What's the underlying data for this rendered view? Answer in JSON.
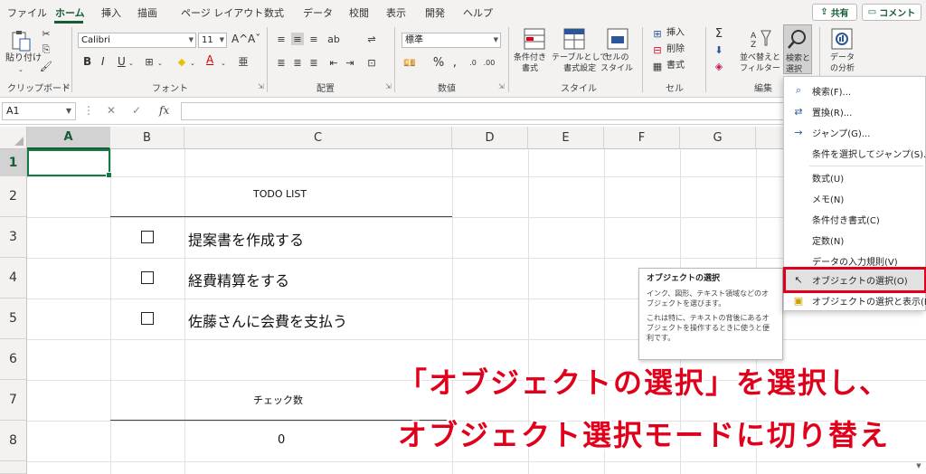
{
  "tabs": [
    "ファイル",
    "ホーム",
    "挿入",
    "描画",
    "ページ レイアウト",
    "数式",
    "データ",
    "校閲",
    "表示",
    "開発",
    "ヘルプ"
  ],
  "share_label": "共有",
  "comment_label": "コメント",
  "ribbon": {
    "clipboard": {
      "paste": "貼り付け",
      "label": "クリップボード"
    },
    "font": {
      "name": "Calibri",
      "size": "11",
      "grow": "A^",
      "shrink": "Aˇ",
      "bold": "B",
      "italic": "I",
      "underline": "U",
      "label": "フォント"
    },
    "alignment": {
      "label": "配置"
    },
    "number": {
      "format": "標準",
      "label": "数値"
    },
    "styles": {
      "cond_format": "条件付き\n書式",
      "table_format": "テーブルとして\n書式設定",
      "cell_style": "セルの\nスタイル",
      "label": "スタイル"
    },
    "cells": {
      "insert": "挿入",
      "delete": "削除",
      "format": "書式",
      "label": "セル"
    },
    "editing": {
      "sort": "並べ替えと\nフィルター",
      "find": "検索と\n選択",
      "label": "編集"
    },
    "analysis": {
      "analyze": "データ\nの分析"
    }
  },
  "formula_bar": {
    "name_box": "A1",
    "fx": "fx"
  },
  "columns": [
    "A",
    "B",
    "C",
    "D",
    "E",
    "F",
    "G"
  ],
  "rows": [
    "1",
    "2",
    "3",
    "4",
    "5",
    "6",
    "7",
    "8"
  ],
  "sheet": {
    "todo_title": "TODO LIST",
    "items": [
      "提案書を作成する",
      "経費精算をする",
      "佐藤さんに会費を支払う"
    ],
    "check_label": "チェック数",
    "check_value": "0"
  },
  "menu": [
    {
      "label": "検索(F)...",
      "icon": "search-icon"
    },
    {
      "label": "置換(R)...",
      "icon": "replace-icon"
    },
    {
      "label": "ジャンプ(G)...",
      "icon": "arrow-right-icon"
    },
    {
      "label": "条件を選択してジャンプ(S)...",
      "icon": ""
    },
    {
      "label": "数式(U)",
      "icon": ""
    },
    {
      "label": "メモ(N)",
      "icon": ""
    },
    {
      "label": "条件付き書式(C)",
      "icon": ""
    },
    {
      "label": "定数(N)",
      "icon": ""
    },
    {
      "label": "データの入力規則(V)",
      "icon": ""
    },
    {
      "label": "オブジェクトの選択(O)",
      "icon": "cursor-icon"
    },
    {
      "label": "オブジェクトの選択と表示(P)...",
      "icon": "selection-pane-icon"
    }
  ],
  "tooltip": {
    "title": "オブジェクトの選択",
    "line1": "インク、図形、テキスト領域などのオブジェクトを選びます。",
    "line2": "これは特に、テキストの背後にあるオブジェクトを操作するときに使うと便利です。"
  },
  "overlay": {
    "line1": "「オブジェクトの選択」を選択し、",
    "line2": "オブジェクト選択モードに切り替え"
  },
  "colors": {
    "accent": "#185c37",
    "highlight": "#e0001b",
    "grid": "#e1e1e1"
  }
}
